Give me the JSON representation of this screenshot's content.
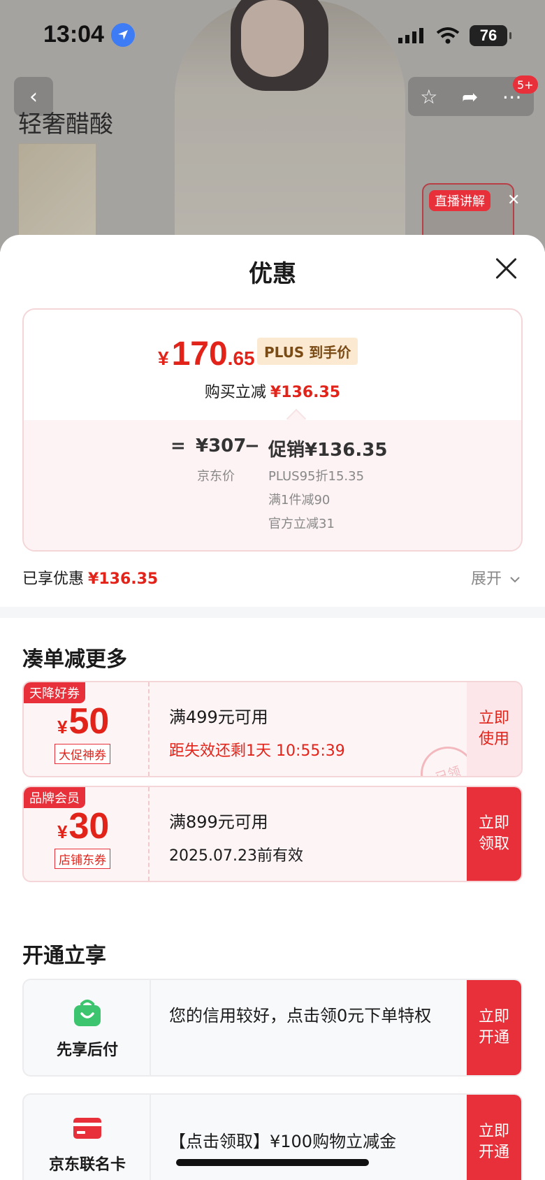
{
  "status_bar": {
    "time": "13:04",
    "battery": "76"
  },
  "background": {
    "title": "轻奢醋酸",
    "cart_badge": "5+",
    "live_tag": "直播讲解"
  },
  "sheet": {
    "title": "优惠",
    "price": {
      "yen": "¥",
      "int": "170",
      "dec": ".65",
      "plus_tag": "PLUS 到手价",
      "buy_reduce_label": "购买立减",
      "buy_reduce_value": "¥136.35",
      "equals": "=",
      "jd_price": "¥307",
      "jd_label": "京东价",
      "minus": "−",
      "promo": "促销¥136.35",
      "promo_items": [
        "PLUS95折15.35",
        "满1件减90",
        "官方立减31"
      ]
    },
    "enjoyed_label": "已享优惠",
    "enjoyed_value": "¥136.35",
    "expand_label": "展开",
    "section_more": "凑单减更多",
    "coupons": [
      {
        "tag": "天降好券",
        "yen": "¥",
        "amount": "50",
        "kind": "大促神券",
        "condition": "满499元可用",
        "sub": "距失效还剩1天 10:55:39",
        "action": "立即\n使用",
        "stamp": "已领"
      },
      {
        "tag": "品牌会员",
        "yen": "¥",
        "amount": "30",
        "kind": "店铺东券",
        "condition": "满899元可用",
        "sub": "2025.07.23前有效",
        "action": "立即\n领取"
      }
    ],
    "section_open": "开通立享",
    "benefits": [
      {
        "label": "先享后付",
        "desc": "您的信用较好，点击领0元下单特权",
        "action": "立即\n开通"
      },
      {
        "label": "京东联名卡",
        "desc": "【点击领取】¥100购物立减金",
        "action": "立即\n开通"
      }
    ]
  },
  "colors": {
    "accent_red": "#e8303a",
    "price_red": "#e2231a",
    "plus_gold": "#7a4b14"
  }
}
